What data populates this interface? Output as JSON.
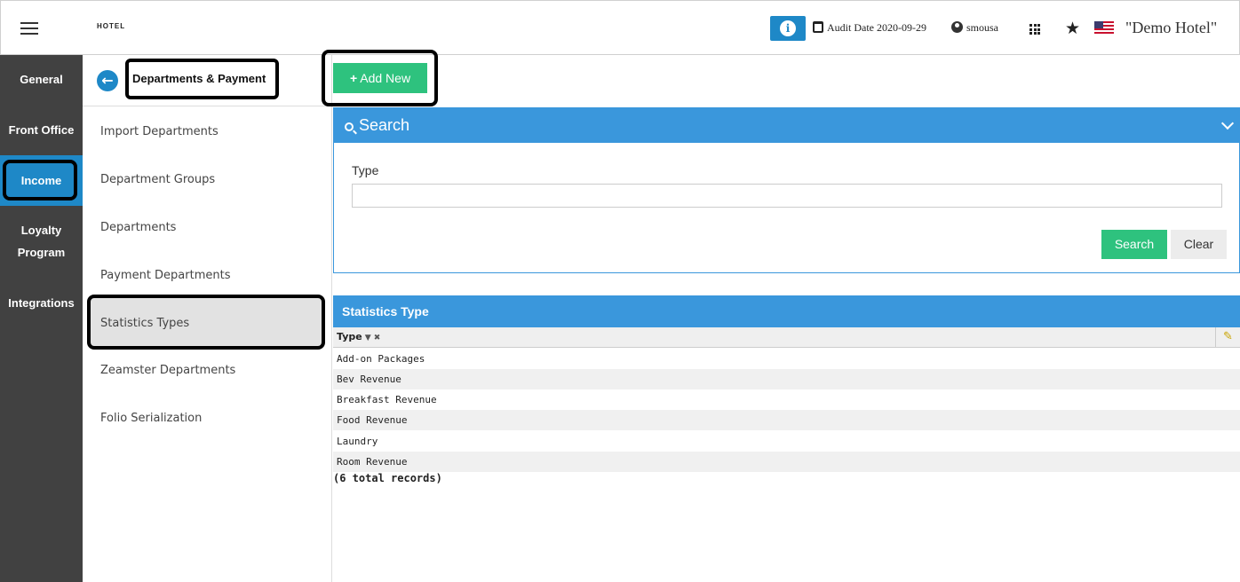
{
  "header": {
    "logo": "HOTEL",
    "audit_label": "Audit Date 2020-09-29",
    "username": "smousa",
    "hotel_name": "\"Demo Hotel\""
  },
  "leftnav": {
    "items": [
      {
        "label": "General"
      },
      {
        "label": "Front Office"
      },
      {
        "label": "Income"
      },
      {
        "label": "Loyalty Program"
      },
      {
        "label": "Integrations"
      }
    ],
    "active": "Income"
  },
  "submenu": {
    "title": "Departments & Payment",
    "items": [
      {
        "label": "Import Departments"
      },
      {
        "label": "Department Groups"
      },
      {
        "label": "Departments"
      },
      {
        "label": "Payment Departments"
      },
      {
        "label": "Statistics Types"
      },
      {
        "label": "Zeamster Departments"
      },
      {
        "label": "Folio Serialization"
      }
    ],
    "active": "Statistics Types"
  },
  "toolbar": {
    "add_label": "Add New"
  },
  "search": {
    "title": "Search",
    "type_label": "Type",
    "type_value": "",
    "search_label": "Search",
    "clear_label": "Clear"
  },
  "table": {
    "title": "Statistics Type",
    "column": "Type",
    "rows": [
      "Add-on Packages",
      "Bev Revenue",
      "Breakfast Revenue",
      "Food Revenue",
      "Laundry",
      "Room Revenue"
    ],
    "total": "(6 total records)"
  },
  "colors": {
    "primary": "#1e88c7",
    "panel": "#3a97dc",
    "green": "#2ec27e",
    "nav_bg": "#414141"
  }
}
